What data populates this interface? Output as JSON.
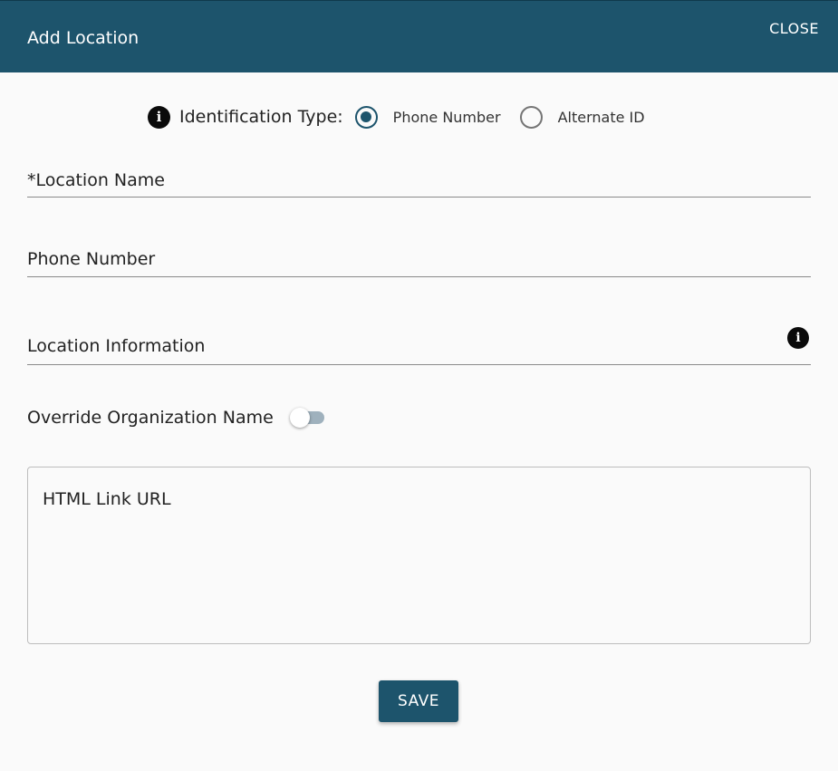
{
  "dialog": {
    "title": "Add Location",
    "close_label": "CLOSE"
  },
  "identification": {
    "label": "Identification Type:",
    "info_icon": "info-icon",
    "options": [
      {
        "label": "Phone Number",
        "selected": true
      },
      {
        "label": "Alternate ID",
        "selected": false
      }
    ]
  },
  "fields": {
    "location_name": {
      "label": "*Location Name",
      "value": ""
    },
    "phone_number": {
      "label": "Phone Number",
      "value": ""
    },
    "location_information": {
      "label": "Location Information",
      "value": "",
      "info_icon": "info-icon"
    }
  },
  "override": {
    "label": "Override Organization Name",
    "enabled": false
  },
  "html_link": {
    "label": "HTML Link URL",
    "value": ""
  },
  "actions": {
    "save_label": "SAVE"
  },
  "colors": {
    "primary": "#1d546c",
    "toggle_track": "#9fb1bd",
    "background": "#fafafa"
  }
}
